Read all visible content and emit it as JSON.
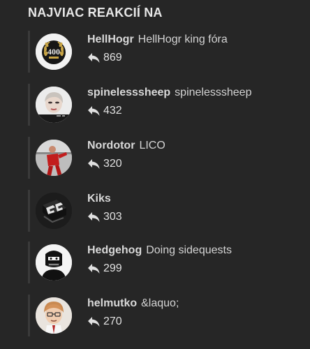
{
  "widget": {
    "title": "NAJVIAC REAKCIÍ NA"
  },
  "users": [
    {
      "name": "HellHogr",
      "title": "HellHogr king fóra",
      "count": "869",
      "avatar": "laurel-400-badge-avatar"
    },
    {
      "name": "spinelesssheep",
      "title": "spinelesssheep",
      "count": "432",
      "avatar": "woman-portrait-avatar"
    },
    {
      "name": "Nordotor",
      "title": "LICO",
      "count": "320",
      "avatar": "football-player-avatar"
    },
    {
      "name": "Kiks",
      "title": "",
      "count": "303",
      "avatar": "geometric-logo-avatar"
    },
    {
      "name": "Hedgehog",
      "title": "Doing sidequests",
      "count": "299",
      "avatar": "masked-figure-avatar"
    },
    {
      "name": "helmutko",
      "title": "&laquo;",
      "count": "270",
      "avatar": "cartoon-face-avatar"
    }
  ],
  "icons": {
    "reply": "reply-arrow-icon"
  },
  "colors": {
    "background": "#262626",
    "rail": "#3a3a3a",
    "text": "#e0e0e0"
  }
}
